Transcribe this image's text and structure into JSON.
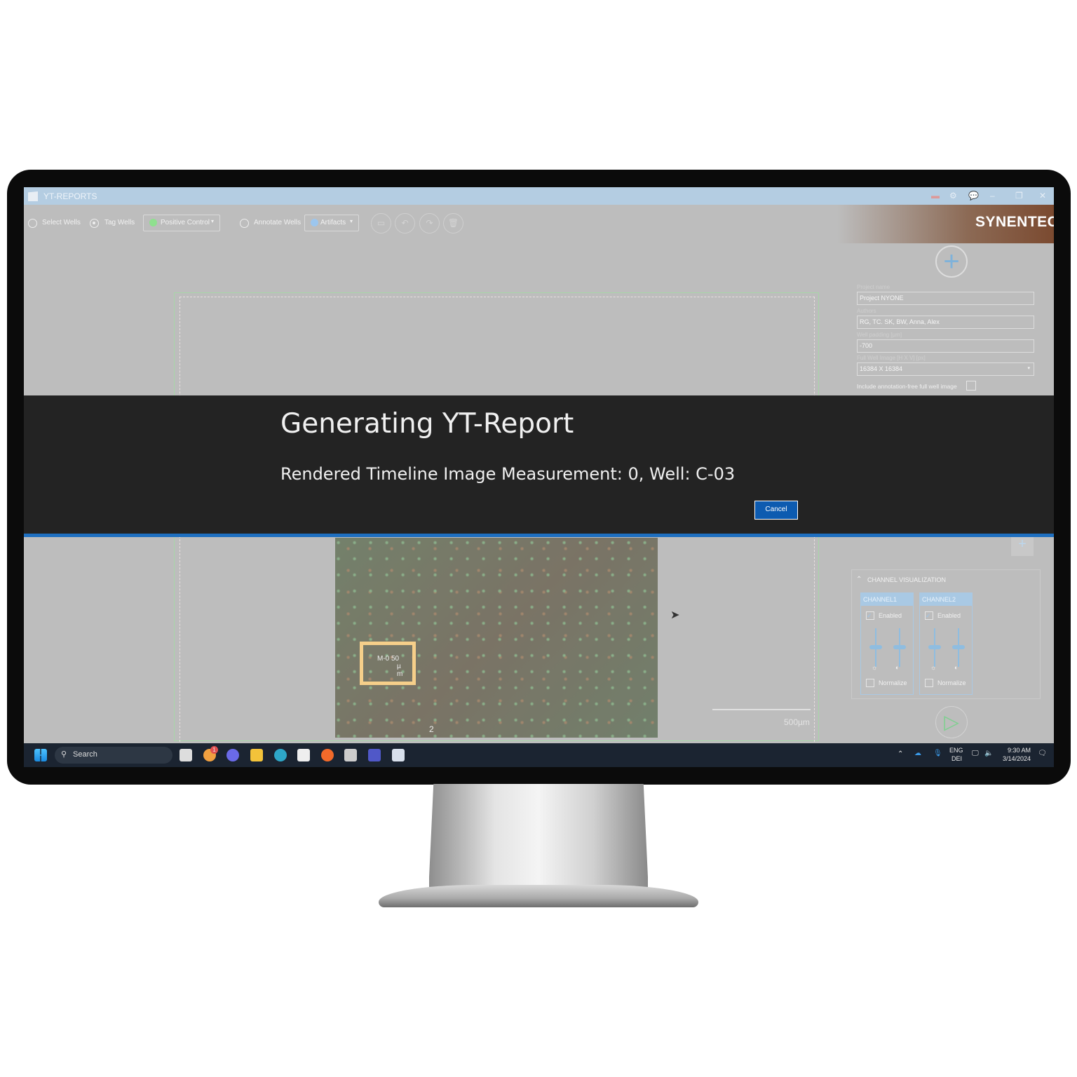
{
  "window": {
    "title": "YT-REPORTS",
    "controls": [
      "minimize",
      "restore",
      "close"
    ]
  },
  "toolbar": {
    "select_wells": "Select Wells",
    "tag_wells": "Tag Wells",
    "tag_dropdown": "Positive Control",
    "tag_color": "#8fe08f",
    "annotate_wells": "Annotate Wells",
    "annotate_dropdown": "Artifacts",
    "annotate_color": "#9cc6ee",
    "selected_mode": "Tag Wells",
    "icon_buttons": [
      "image-icon",
      "undo-icon",
      "redo-icon",
      "delete-icon"
    ]
  },
  "brand": {
    "logo": "SYNENTEC"
  },
  "settings": {
    "project_name_label": "Project name",
    "project_name": "Project NYONE",
    "authors_label": "Authors",
    "authors": "RG, TC. SK, BW, Anna, Alex",
    "well_padding_label": "Well padding [µm]",
    "well_padding": "-700",
    "full_well_label": "Full Well Image [H X V] [px]",
    "full_well": "16384  X  16384",
    "include_label": "Include annotation-free full well image",
    "include_checked": false
  },
  "dialog": {
    "title": "Generating YT-Report",
    "message": "Rendered Timeline Image Measurement: 0,  Well: C-03",
    "cancel": "Cancel"
  },
  "image": {
    "tag_text": "M-0 50",
    "tag_unit_1": "µ",
    "tag_unit_2": "m",
    "marker": "2",
    "scale": "500µm"
  },
  "channels": {
    "section_title": "CHANNEL VISUALIZATION",
    "items": [
      {
        "name": "CHANNEL1",
        "enabled_label": "Enabled",
        "enabled": true,
        "normalize_label": "Normalize",
        "normalize": false
      },
      {
        "name": "CHANNEL2",
        "enabled_label": "Enabled",
        "enabled": true,
        "normalize_label": "Normalize",
        "normalize": false
      }
    ]
  },
  "taskbar": {
    "search": "Search",
    "lang_1": "ENG",
    "lang_2": "DEI",
    "time": "9:30 AM",
    "date": "3/14/2024",
    "notification_badge": "1"
  }
}
